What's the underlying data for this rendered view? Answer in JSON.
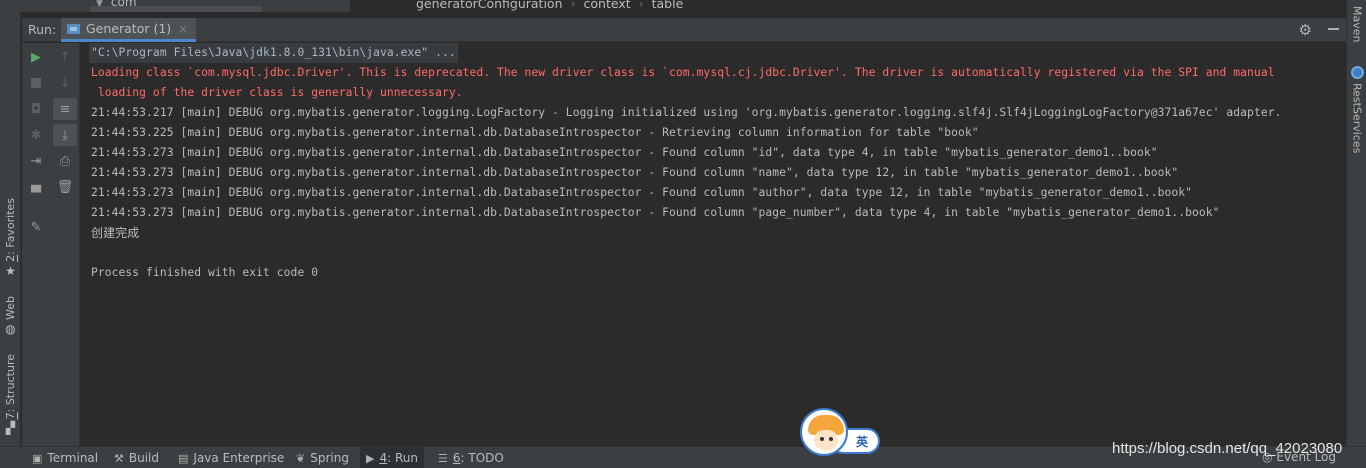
{
  "top": {
    "tree_item": "com",
    "breadcrumbs": [
      "generatorConfiguration",
      "context",
      "table"
    ]
  },
  "left_tabs": {
    "favorites_num": "2",
    "favorites_text": ": Favorites",
    "web": "Web",
    "structure_num": "7",
    "structure_text": ": Structure"
  },
  "right_tabs": {
    "maven": "Maven",
    "rest": "RestServices"
  },
  "run_panel": {
    "label": "Run:",
    "tab_label": "Generator (1)",
    "tab_close": "×"
  },
  "icons": {
    "settings": "gear-icon",
    "minimize": "minimize-icon",
    "rerun": "rerun-icon",
    "stop": "stop-icon",
    "screenshot": "camera-icon",
    "debug": "bug-icon",
    "exit": "exit-icon",
    "layout": "layout-icon",
    "pin": "pin-icon",
    "up": "arrow-up-icon",
    "down": "arrow-down-icon",
    "soft_wrap": "soft-wrap-icon",
    "scroll_end": "scroll-to-end-icon",
    "print": "print-icon",
    "trash": "trash-icon"
  },
  "console": {
    "command": "\"C:\\Program Files\\Java\\jdk1.8.0_131\\bin\\java.exe\" ...",
    "err1": "Loading class `com.mysql.jdbc.Driver'. This is deprecated. The new driver class is `com.mysql.cj.jdbc.Driver'. The driver is automatically registered via the SPI and manual",
    "err2": " loading of the driver class is generally unnecessary.",
    "log1": "21:44:53.217 [main] DEBUG org.mybatis.generator.logging.LogFactory - Logging initialized using 'org.mybatis.generator.logging.slf4j.Slf4jLoggingLogFactory@371a67ec' adapter.",
    "log2": "21:44:53.225 [main] DEBUG org.mybatis.generator.internal.db.DatabaseIntrospector - Retrieving column information for table \"book\"",
    "log3": "21:44:53.273 [main] DEBUG org.mybatis.generator.internal.db.DatabaseIntrospector - Found column \"id\", data type 4, in table \"mybatis_generator_demo1..book\"",
    "log4": "21:44:53.273 [main] DEBUG org.mybatis.generator.internal.db.DatabaseIntrospector - Found column \"name\", data type 12, in table \"mybatis_generator_demo1..book\"",
    "log5": "21:44:53.273 [main] DEBUG org.mybatis.generator.internal.db.DatabaseIntrospector - Found column \"author\", data type 12, in table \"mybatis_generator_demo1..book\"",
    "log6": "21:44:53.273 [main] DEBUG org.mybatis.generator.internal.db.DatabaseIntrospector - Found column \"page_number\", data type 4, in table \"mybatis_generator_demo1..book\"",
    "done": "创建完成",
    "exit": "Process finished with exit code 0"
  },
  "bottom": {
    "terminal": "Terminal",
    "build": "Build",
    "java_enterprise": "Java Enterprise",
    "spring": "Spring",
    "run_num": "4",
    "run_text": ": Run",
    "todo_num": "6",
    "todo_text": ": TODO",
    "event_log": "Event Log"
  },
  "ime": {
    "lang": "英"
  },
  "watermark": "https://blog.csdn.net/qq_42023080",
  "colors": {
    "background": "#2b2b2b",
    "panel": "#3c3f41",
    "error": "#ff6b68",
    "accent": "#4a88c7",
    "run_green": "#59a869"
  }
}
